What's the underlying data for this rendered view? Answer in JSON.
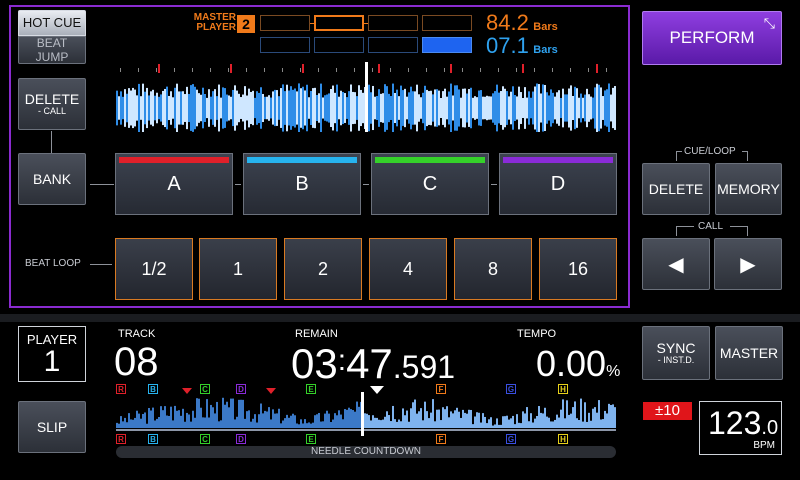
{
  "mode_buttons": {
    "hot_cue": "HOT CUE",
    "beat_jump": "BEAT JUMP"
  },
  "delete_call": {
    "label": "DELETE",
    "sub": "- CALL"
  },
  "bank": "BANK",
  "beat_loop_label": "BEAT LOOP",
  "master_player": {
    "line1": "MASTER",
    "line2": "PLAYER",
    "number": "2"
  },
  "bars": {
    "top_value": "84.2",
    "top_unit": "Bars",
    "bottom_value": "07.1",
    "bottom_unit": "Bars"
  },
  "perform": "PERFORM",
  "hot_cues": [
    {
      "label": "A",
      "color": "#e0202a"
    },
    {
      "label": "B",
      "color": "#27b3ee"
    },
    {
      "label": "C",
      "color": "#35d12a"
    },
    {
      "label": "D",
      "color": "#8a2bd8"
    }
  ],
  "beat_loops": [
    "1/2",
    "1",
    "2",
    "4",
    "8",
    "16"
  ],
  "cue_loop": {
    "header": "CUE/LOOP",
    "delete": "DELETE",
    "memory": "MEMORY",
    "call": "CALL",
    "prev": "◀",
    "next": "▶"
  },
  "player": {
    "label": "PLAYER",
    "number": "1"
  },
  "slip": "SLIP",
  "track": {
    "label": "TRACK",
    "value": "08"
  },
  "remain": {
    "label": "REMAIN",
    "min": "03",
    "sec": "47",
    "ms": ".591"
  },
  "tempo": {
    "label": "TEMPO",
    "value": "0.00",
    "unit": "%"
  },
  "sync": {
    "label": "SYNC",
    "sub": "- INST.D."
  },
  "master": "MASTER",
  "tempo_range": "±10",
  "bpm": {
    "value": "123",
    "decimal": ".0",
    "unit": "BPM"
  },
  "needle_countdown": "NEEDLE COUNTDOWN",
  "cue_markers": [
    {
      "letter": "R",
      "color": "#e0202a"
    },
    {
      "letter": "B",
      "color": "#27b3ee"
    },
    {
      "letter": "C",
      "color": "#35d12a"
    },
    {
      "letter": "D",
      "color": "#8a2bd8"
    },
    {
      "letter": "E",
      "color": "#35d12a"
    },
    {
      "letter": "F",
      "color": "#f07a1a"
    },
    {
      "letter": "G",
      "color": "#3a4fe0"
    },
    {
      "letter": "H",
      "color": "#e8d21a"
    }
  ],
  "playhead_fraction": 0.47,
  "overview_playhead_fraction": 0.49
}
